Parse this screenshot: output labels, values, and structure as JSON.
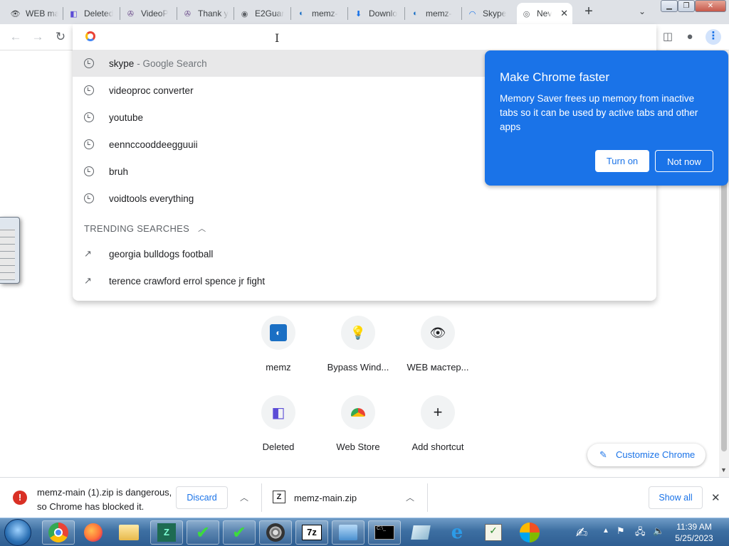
{
  "tabs": [
    {
      "title": "WEB ma",
      "icon": "eye-icon",
      "color": "#5b3a2a"
    },
    {
      "title": "Deleted",
      "icon": "deleted-icon",
      "color": "#5c4dd6"
    },
    {
      "title": "VideoP",
      "icon": "film-reel-icon",
      "color": "#6a4a8a"
    },
    {
      "title": "Thank y",
      "icon": "film-reel-icon",
      "color": "#6a4a8a"
    },
    {
      "title": "E2Guar",
      "icon": "globe-icon",
      "color": "#5f6368"
    },
    {
      "title": "memz-",
      "icon": "memz-icon",
      "color": "#1a6fc4"
    },
    {
      "title": "Downlo",
      "icon": "download-icon",
      "color": "#1a73e8"
    },
    {
      "title": "memz-",
      "icon": "memz-icon",
      "color": "#1a6fc4"
    },
    {
      "title": "Skype",
      "icon": "loading-icon",
      "color": "#1a73e8"
    },
    {
      "title": "Nev",
      "icon": "chrome-icon",
      "color": "#5f6368"
    }
  ],
  "omnibox": {
    "suggestions": [
      {
        "text": "skype",
        "sub": "- Google Search",
        "highlighted": true
      },
      {
        "text": "videoproc converter",
        "sub": ""
      },
      {
        "text": "youtube",
        "sub": ""
      },
      {
        "text": "eennccooddeegguuii",
        "sub": ""
      },
      {
        "text": "bruh",
        "sub": ""
      },
      {
        "text": "voidtools everything",
        "sub": ""
      }
    ],
    "trending_header": "TRENDING SEARCHES",
    "trending": [
      {
        "text": "georgia bulldogs football"
      },
      {
        "text": "terence crawford errol spence jr fight"
      }
    ]
  },
  "promo": {
    "title": "Make Chrome faster",
    "body": "Memory Saver frees up memory from inactive tabs so it can be used by active tabs and other apps",
    "turn_on": "Turn on",
    "not_now": "Not now"
  },
  "shortcuts": [
    {
      "label": "memz",
      "icon": "memz-icon"
    },
    {
      "label": "Bypass Wind...",
      "icon": "lightbulb-icon"
    },
    {
      "label": "WEB мастер...",
      "icon": "eye-icon"
    },
    {
      "label": "Deleted",
      "icon": "deleted-icon"
    },
    {
      "label": "Web Store",
      "icon": "web-store-icon"
    },
    {
      "label": "Add shortcut",
      "icon": "plus-icon"
    }
  ],
  "customize_label": "Customize Chrome",
  "downloads": {
    "blocked_line1": "memz-main (1).zip is dangerous,",
    "blocked_line2": "so Chrome has blocked it.",
    "discard": "Discard",
    "file2": "memz-main.zip",
    "show_all": "Show all"
  },
  "clock": {
    "time": "11:39 AM",
    "date": "5/25/2023"
  }
}
